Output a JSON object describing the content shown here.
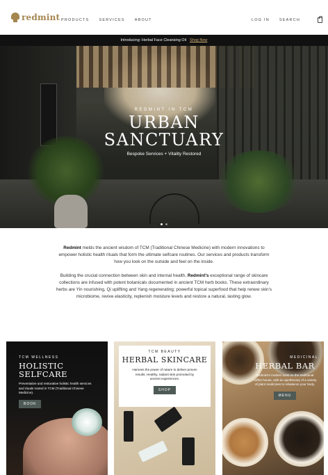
{
  "brand": {
    "name": "redmint",
    "color": "#a4864f"
  },
  "nav": {
    "left": [
      "PRODUCTS",
      "SERVICES",
      "ABOUT"
    ],
    "right": [
      "LOG IN",
      "SEARCH"
    ],
    "cart_icon": "bag-icon"
  },
  "announcement": {
    "text": "Introducing: Herbal Face Cleansing Oil",
    "link": "Shop Now"
  },
  "hero": {
    "kicker": "REDMINT IN TCM",
    "title_line1": "URBAN",
    "title_line2": "SANCTUARY",
    "subtitle": "Bespoke Services + Vitality Restored",
    "slide_count": 2,
    "active_slide": 1
  },
  "intro": {
    "p1_brand": "Redmint",
    "p1_text": " melds the ancient wisdom of TCM (Traditional Chinese Medicine) with modern innovations to empower holistic health rituals that form the ultimate selfcare routines. Our services and products transform how you look on the outside and feel on the inside.",
    "p2_text1": "Building the crucial connection between skin and internal health, ",
    "p2_brand": "Redmint's",
    "p2_text2": " exceptional range of skincare collections are infused with potent botanicals documented in ancient TCM herb books. These extraordinary herbs are Yin nourishing, Qi uplifting and Yang regenerating; powerful topical superfood that help renew skin's microbiome, revive elasticity, replenish moisture levels and restore a natural, lasting glow."
  },
  "cards": [
    {
      "kicker": "TCM WELLNESS",
      "title_line1": "HOLISTIC",
      "title_line2": "SELFCARE",
      "description": "Preventative and restorative holistic health services and rituals rooted in TCM (Traditional Chinese Medicine).",
      "button": "BOOK"
    },
    {
      "kicker": "TCM BEAUTY",
      "title": "HERBAL SKINCARE",
      "description": "Harness the power of nature to deliver proven results. Healthy, radiant skin promoted by ancient experiences.",
      "button": "SHOP"
    },
    {
      "kicker": "MEDICINAL",
      "title": "HERBAL BAR",
      "description": "Redmint's modern twist on the traditional coffee house, with an apothecary of a variety of plant medicines to rebalance your body.",
      "button": "MENU"
    }
  ],
  "colors": {
    "button": "#4e5a56",
    "announcement_bg": "#111111",
    "announcement_link": "#d6b57a"
  }
}
